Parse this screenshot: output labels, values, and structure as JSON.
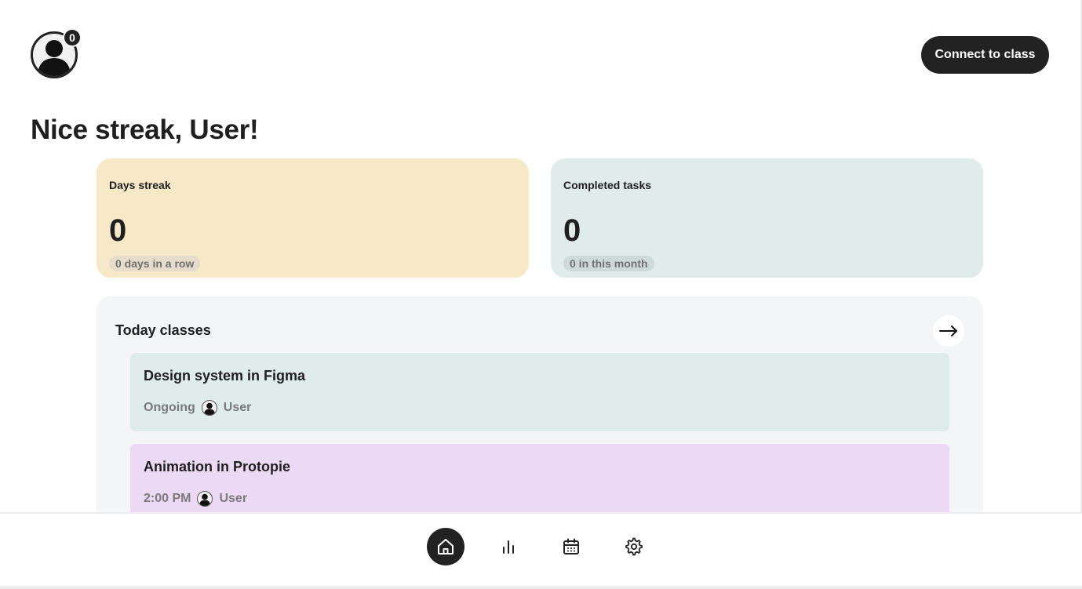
{
  "header": {
    "notification_count": "0",
    "connect_label": "Connect to class"
  },
  "greeting": "Nice streak, User!",
  "stats": {
    "streak": {
      "title": "Days streak",
      "value": "0",
      "subtitle": "0 days in a row",
      "color": "#f7e8c7"
    },
    "tasks": {
      "title": "Completed tasks",
      "value": "0",
      "subtitle": "0 in this month",
      "color": "#dfecea"
    }
  },
  "today_classes": {
    "title": "Today classes",
    "arrow_icon": "arrow-right-icon",
    "items": [
      {
        "name": "Design system in Figma",
        "status": "Ongoing",
        "teacher": "User",
        "color": "#dfecea"
      },
      {
        "name": "Animation in Protopie",
        "status": "2:00 PM",
        "teacher": "User",
        "color": "#ecd9f5"
      }
    ]
  },
  "nav": {
    "items": [
      {
        "icon": "home-icon",
        "active": true
      },
      {
        "icon": "bar-chart-icon",
        "active": false
      },
      {
        "icon": "calendar-icon",
        "active": false
      },
      {
        "icon": "settings-icon",
        "active": false
      }
    ]
  },
  "colors": {
    "dark": "#222222",
    "panel_bg": "#f4f5f7"
  }
}
